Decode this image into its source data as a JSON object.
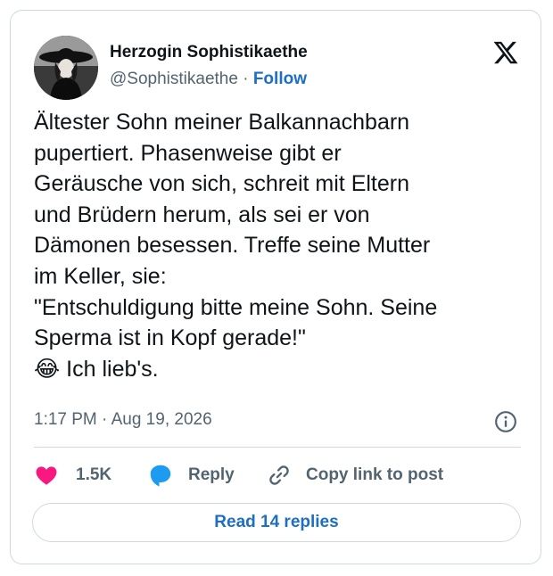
{
  "author": {
    "display_name": "Herzogin Sophistikaethe",
    "handle": "@Sophistikaethe",
    "separator": " · ",
    "follow_label": "Follow"
  },
  "tweet": {
    "lines": [
      "Ältester Sohn meiner Balkannachbarn",
      "pupertiert. Phasenweise gibt er",
      "Geräusche von sich, schreit mit Eltern",
      "und Brüdern herum, als sei er von",
      "Dämonen besessen. Treffe seine Mutter",
      "im Keller, sie:",
      "\"Entschuldigung bitte meine Sohn. Seine",
      "Sperma ist in Kopf gerade!\""
    ],
    "last_line_emoji": "😂",
    "last_line_text": " Ich lieb's.",
    "timestamp": "1:17 PM · Aug 19, 2026"
  },
  "actions": {
    "like_count": "1.5K",
    "reply_label": "Reply",
    "copy_link_label": "Copy link to post"
  },
  "read_replies_label": "Read 14 replies",
  "colors": {
    "link_blue": "#1d6fc1",
    "heart_pink": "#f91880",
    "reply_blue": "#1d9bf0",
    "secondary_text": "#536471",
    "border": "#cfd9de"
  },
  "icons": {
    "logo": "x-logo-icon",
    "info": "info-icon",
    "like": "heart-icon",
    "reply": "speech-bubble-icon",
    "copy_link": "link-icon"
  }
}
